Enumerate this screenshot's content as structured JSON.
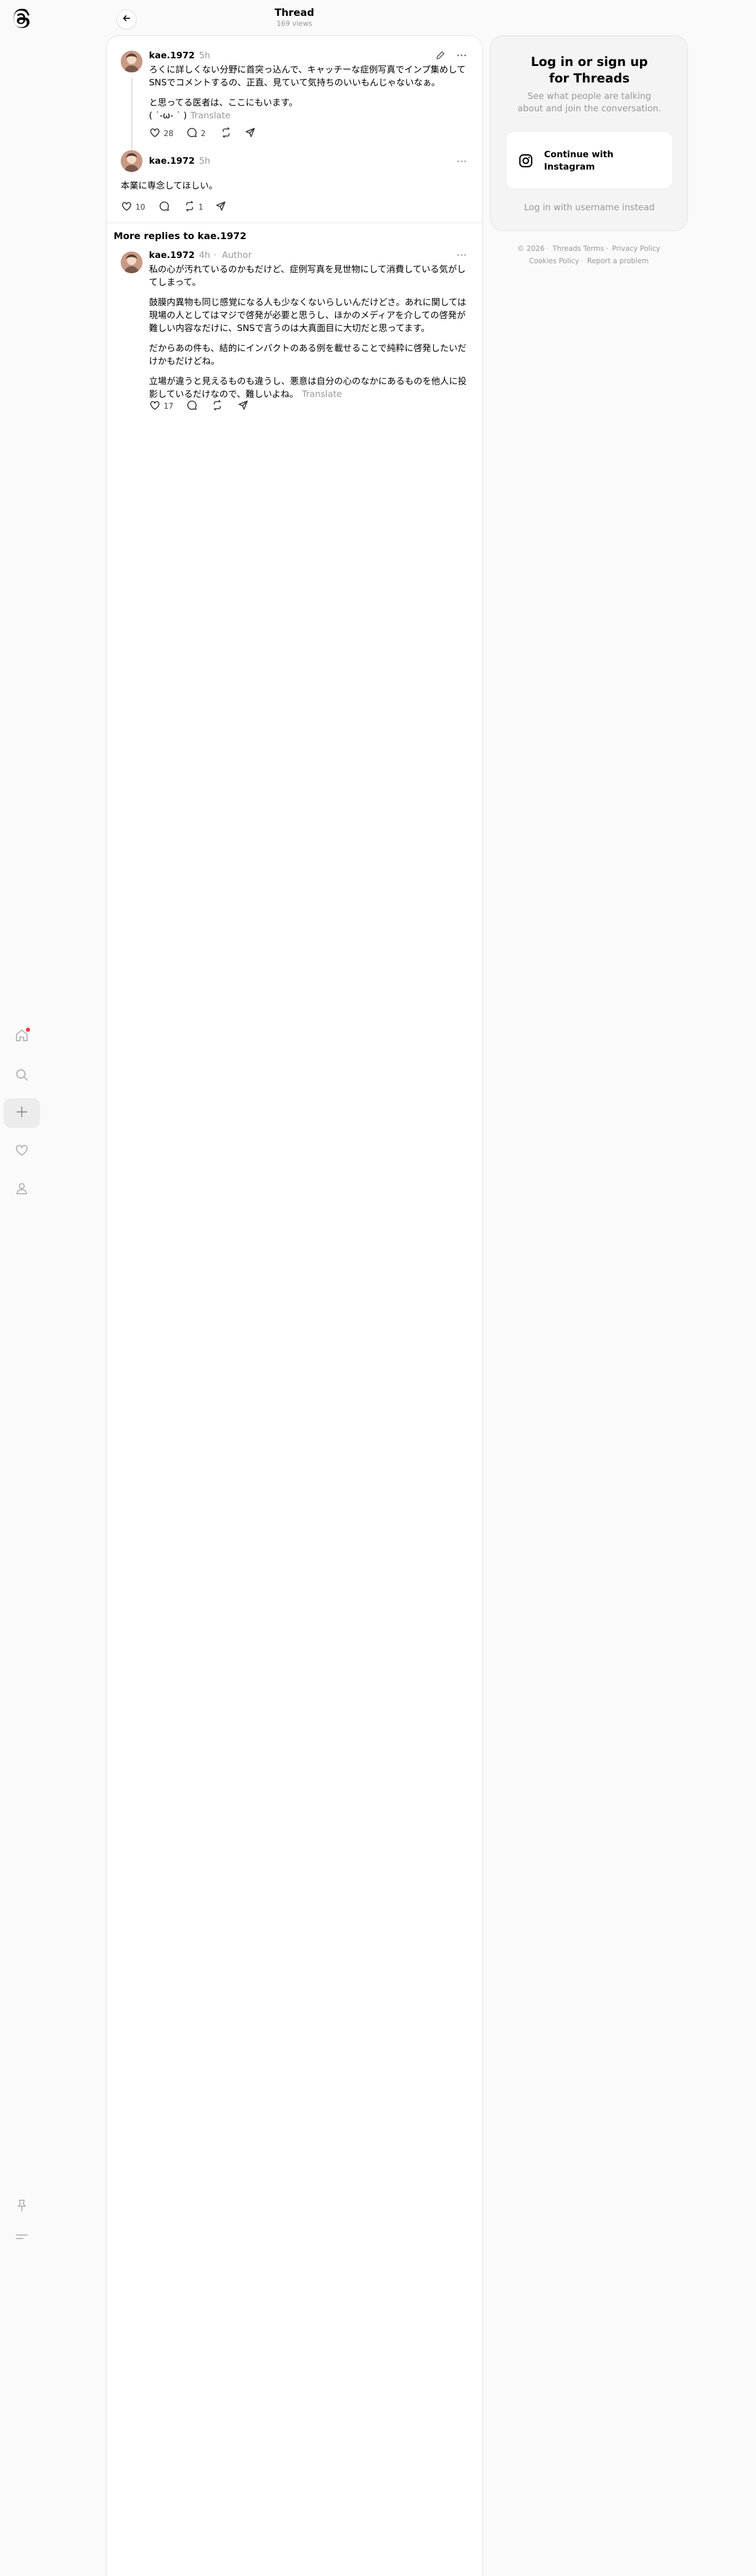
{
  "header": {
    "title": "Thread",
    "views": "169 views"
  },
  "post": {
    "username": "kae.1972",
    "time": "5h",
    "paragraphs": [
      "ろくに詳しくない分野に首突っ込んで、キャッチーな症例写真でインプ集めしてSNSでコメントするの、正直、見ていて気持ちのいいもんじゃないなぁ。",
      "と思ってる医者は、ここにもいます。"
    ],
    "last_line": "( ˙-ω- ˙ )",
    "translate": "Translate",
    "likes": "28",
    "replies": "2",
    "reposts": "",
    "shares": ""
  },
  "reply": {
    "username": "kae.1972",
    "time": "5h",
    "text": "本業に専念してほしい。",
    "likes": "10",
    "replies": "",
    "reposts": "1"
  },
  "more_replies": {
    "title": "More replies to kae.1972",
    "username": "kae.1972",
    "time": "4h",
    "author_badge": "Author",
    "paragraphs": [
      "私の心が汚れているのかもだけど、症例写真を見世物にして消費している気がしてしまって。",
      "鼓膜内異物も同じ感覚になる人も少なくないらしいんだけどさ。あれに関しては現場の人としてはマジで啓発が必要と思うし、ほかのメディアを介しての啓発が難しい内容なだけに、SNSで言うのは大真面目に大切だと思ってます。",
      "だからあの件も、結的にインパクトのある例を載せることで純粋に啓発したいだけかもだけどね。"
    ],
    "last_line": "立場が違うと見えるものも違うし、悪意は自分の心のなかにあるものを他人に投影しているだけなので、難しいよね。",
    "translate": "Translate",
    "likes": "17"
  },
  "login": {
    "title_line1": "Log in or sign up",
    "title_line2": "for Threads",
    "subtitle": "See what people are talking about and join the conversation.",
    "instagram_button": "Continue with Instagram",
    "alt_login": "Log in with username instead"
  },
  "footer": {
    "copyright": "© 2026",
    "terms": "Threads Terms",
    "privacy": "Privacy Policy",
    "cookies": "Cookies Policy",
    "report": "Report a problem"
  }
}
